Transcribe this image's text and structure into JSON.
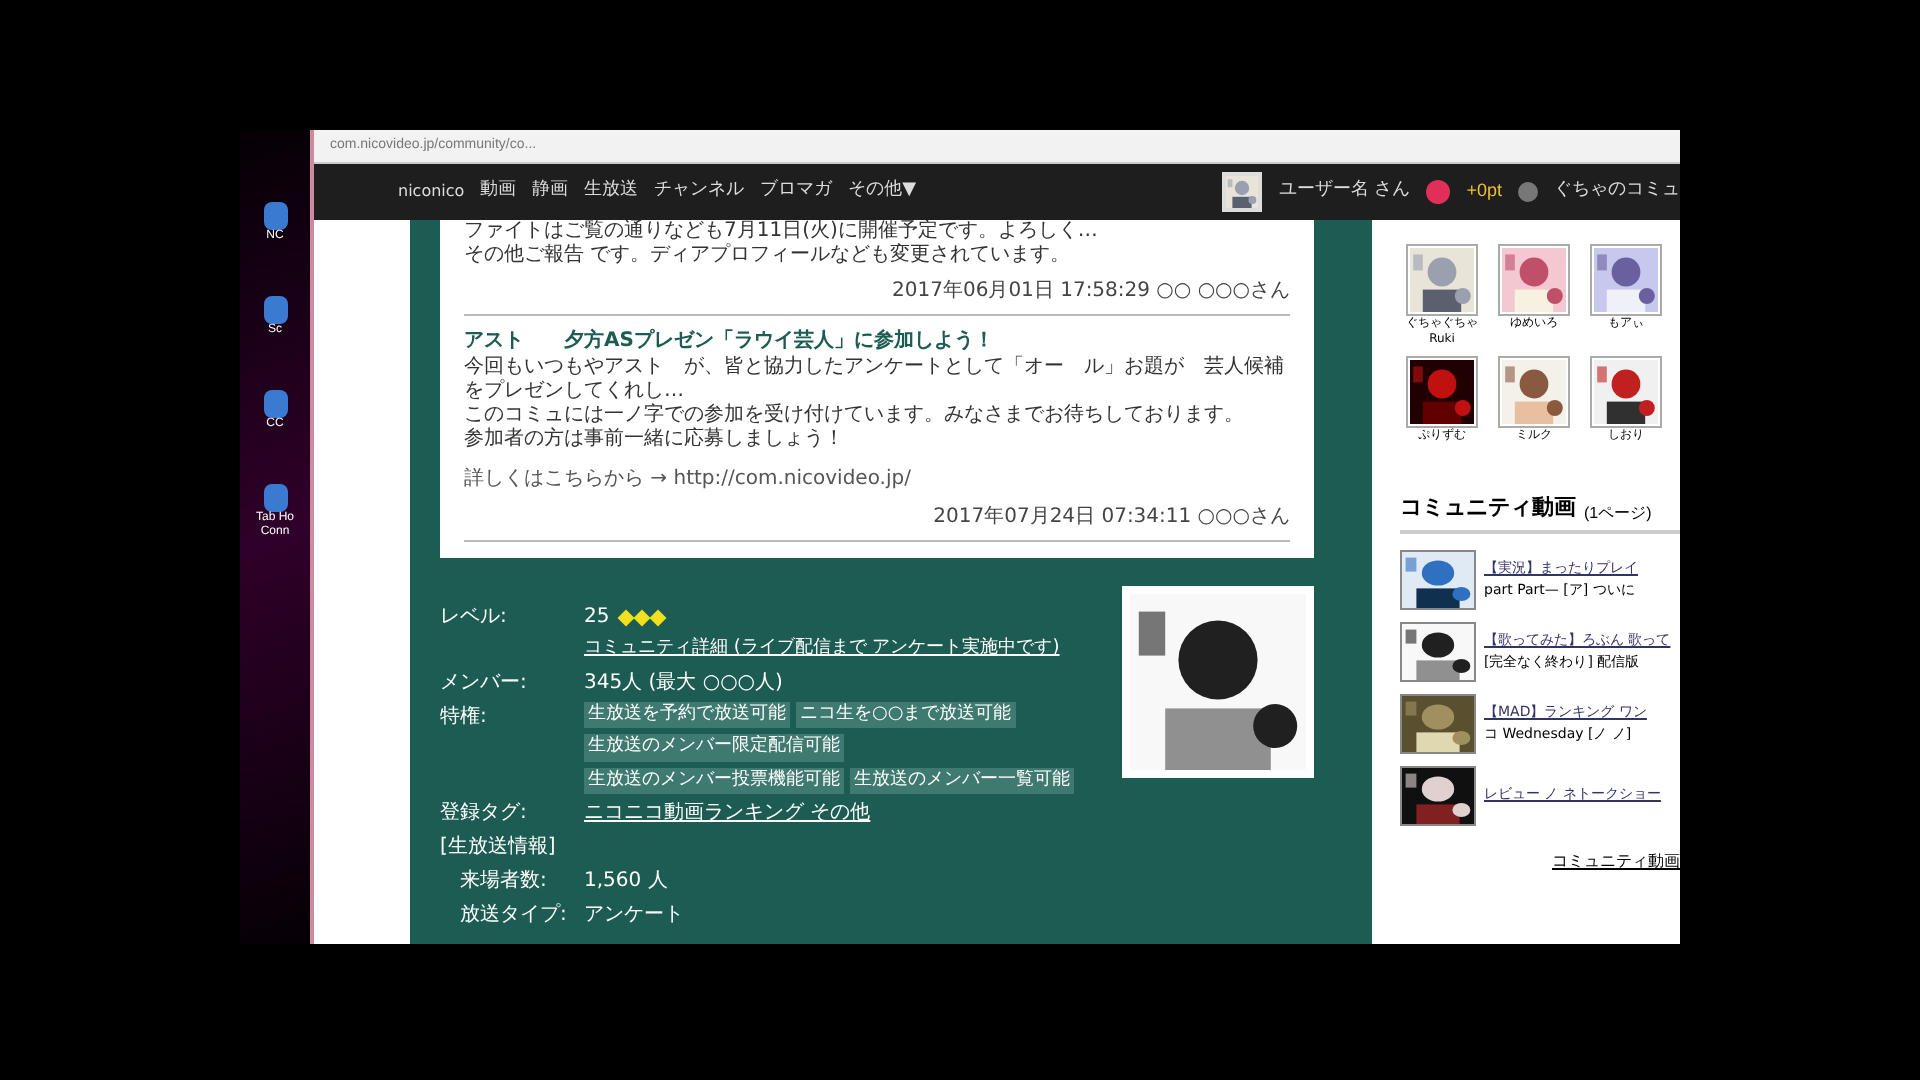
{
  "desktop": {
    "icons": [
      {
        "label": "NC"
      },
      {
        "label": "Sc"
      },
      {
        "label": "CC"
      },
      {
        "label": "Tab Ho Conn"
      }
    ]
  },
  "browser": {
    "address": "com.nicovideo.jp/community/co..."
  },
  "nav": {
    "items": [
      {
        "label": "niconico"
      },
      {
        "label": "動画"
      },
      {
        "label": "静画"
      },
      {
        "label": "生放送"
      },
      {
        "label": "チャンネル"
      },
      {
        "label": "ブロマガ"
      },
      {
        "label": "その他▼"
      }
    ],
    "user": "ユーザー名 さん",
    "points": "+0pt",
    "right_text": "ぐちゃのコミュ"
  },
  "news": [
    {
      "body": [
        "ファイトはご覧の通りなども7月11日(火)に開催予定です。よろしく…",
        "その他ご報告 です。ディアプロフィールなども変更されています。"
      ],
      "date": "2017年06月01日 17:58:29 ○○ ○○○さん"
    },
    {
      "title": "アスト　　夕方ASプレゼン「ラウイ芸人」に参加しよう！",
      "body": [
        "今回もいつもやアスト　が、皆と協力したアンケートとして「オー　ル」お題が　芸人候補をプレゼンしてくれし…",
        "このコミュには一ノ字での参加を受け付けています。みなさまでお待ちしております。",
        "参加者の方は事前一緒に応募しましょう！"
      ],
      "link": "詳しくはこちらから → http://com.nicovideo.jp/",
      "date": "2017年07月24日 07:34:11 ○○○さん"
    }
  ],
  "details": [
    {
      "label": "レベル:",
      "value": "25",
      "stars": 3,
      "extra": "コミュニティ詳細 (ライブ配信まで アンケート実施中です)"
    },
    {
      "label": "メンバー:",
      "value": "345人 (最大 ○○○人)"
    },
    {
      "label": "特権:",
      "tags": [
        "生放送を予約で放送可能",
        "ニコ生を○○まで放送可能",
        "生放送のメンバー限定配信可能",
        "生放送のメンバー投票機能可能",
        "生放送のメンバー一覧可能"
      ]
    },
    {
      "label": "登録タグ:",
      "value": "ニコニコ動画ランキング その他"
    }
  ],
  "live_header": "[生放送情報]",
  "live": [
    {
      "label": "来場者数:",
      "value": "1,560 人"
    },
    {
      "label": "放送タイプ:",
      "value": "アンケート"
    }
  ],
  "members": [
    {
      "name": "ぐちゃぐちゃ Ruki"
    },
    {
      "name": "ゆめいろ"
    },
    {
      "name": "もアぃ"
    },
    {
      "name": "ぷりずむ"
    },
    {
      "name": "ミルク"
    },
    {
      "name": "しおり"
    }
  ],
  "community_videos": {
    "title": "コミュニティ動画",
    "count": "(1ページ)",
    "items": [
      {
        "line1": "【実況】まったりプレイ",
        "line2": "part Part— [ア] ついに"
      },
      {
        "line1": "【歌ってみた】ろぶん 歌って",
        "line2": "[完全なく終わり] 配信版"
      },
      {
        "line1": "【MAD】ランキング ワン",
        "line2": "コ Wednesday [ノ ノ]"
      },
      {
        "line1": "レビュー ノ ネトークショー"
      }
    ],
    "more": "コミュニティ動画"
  }
}
